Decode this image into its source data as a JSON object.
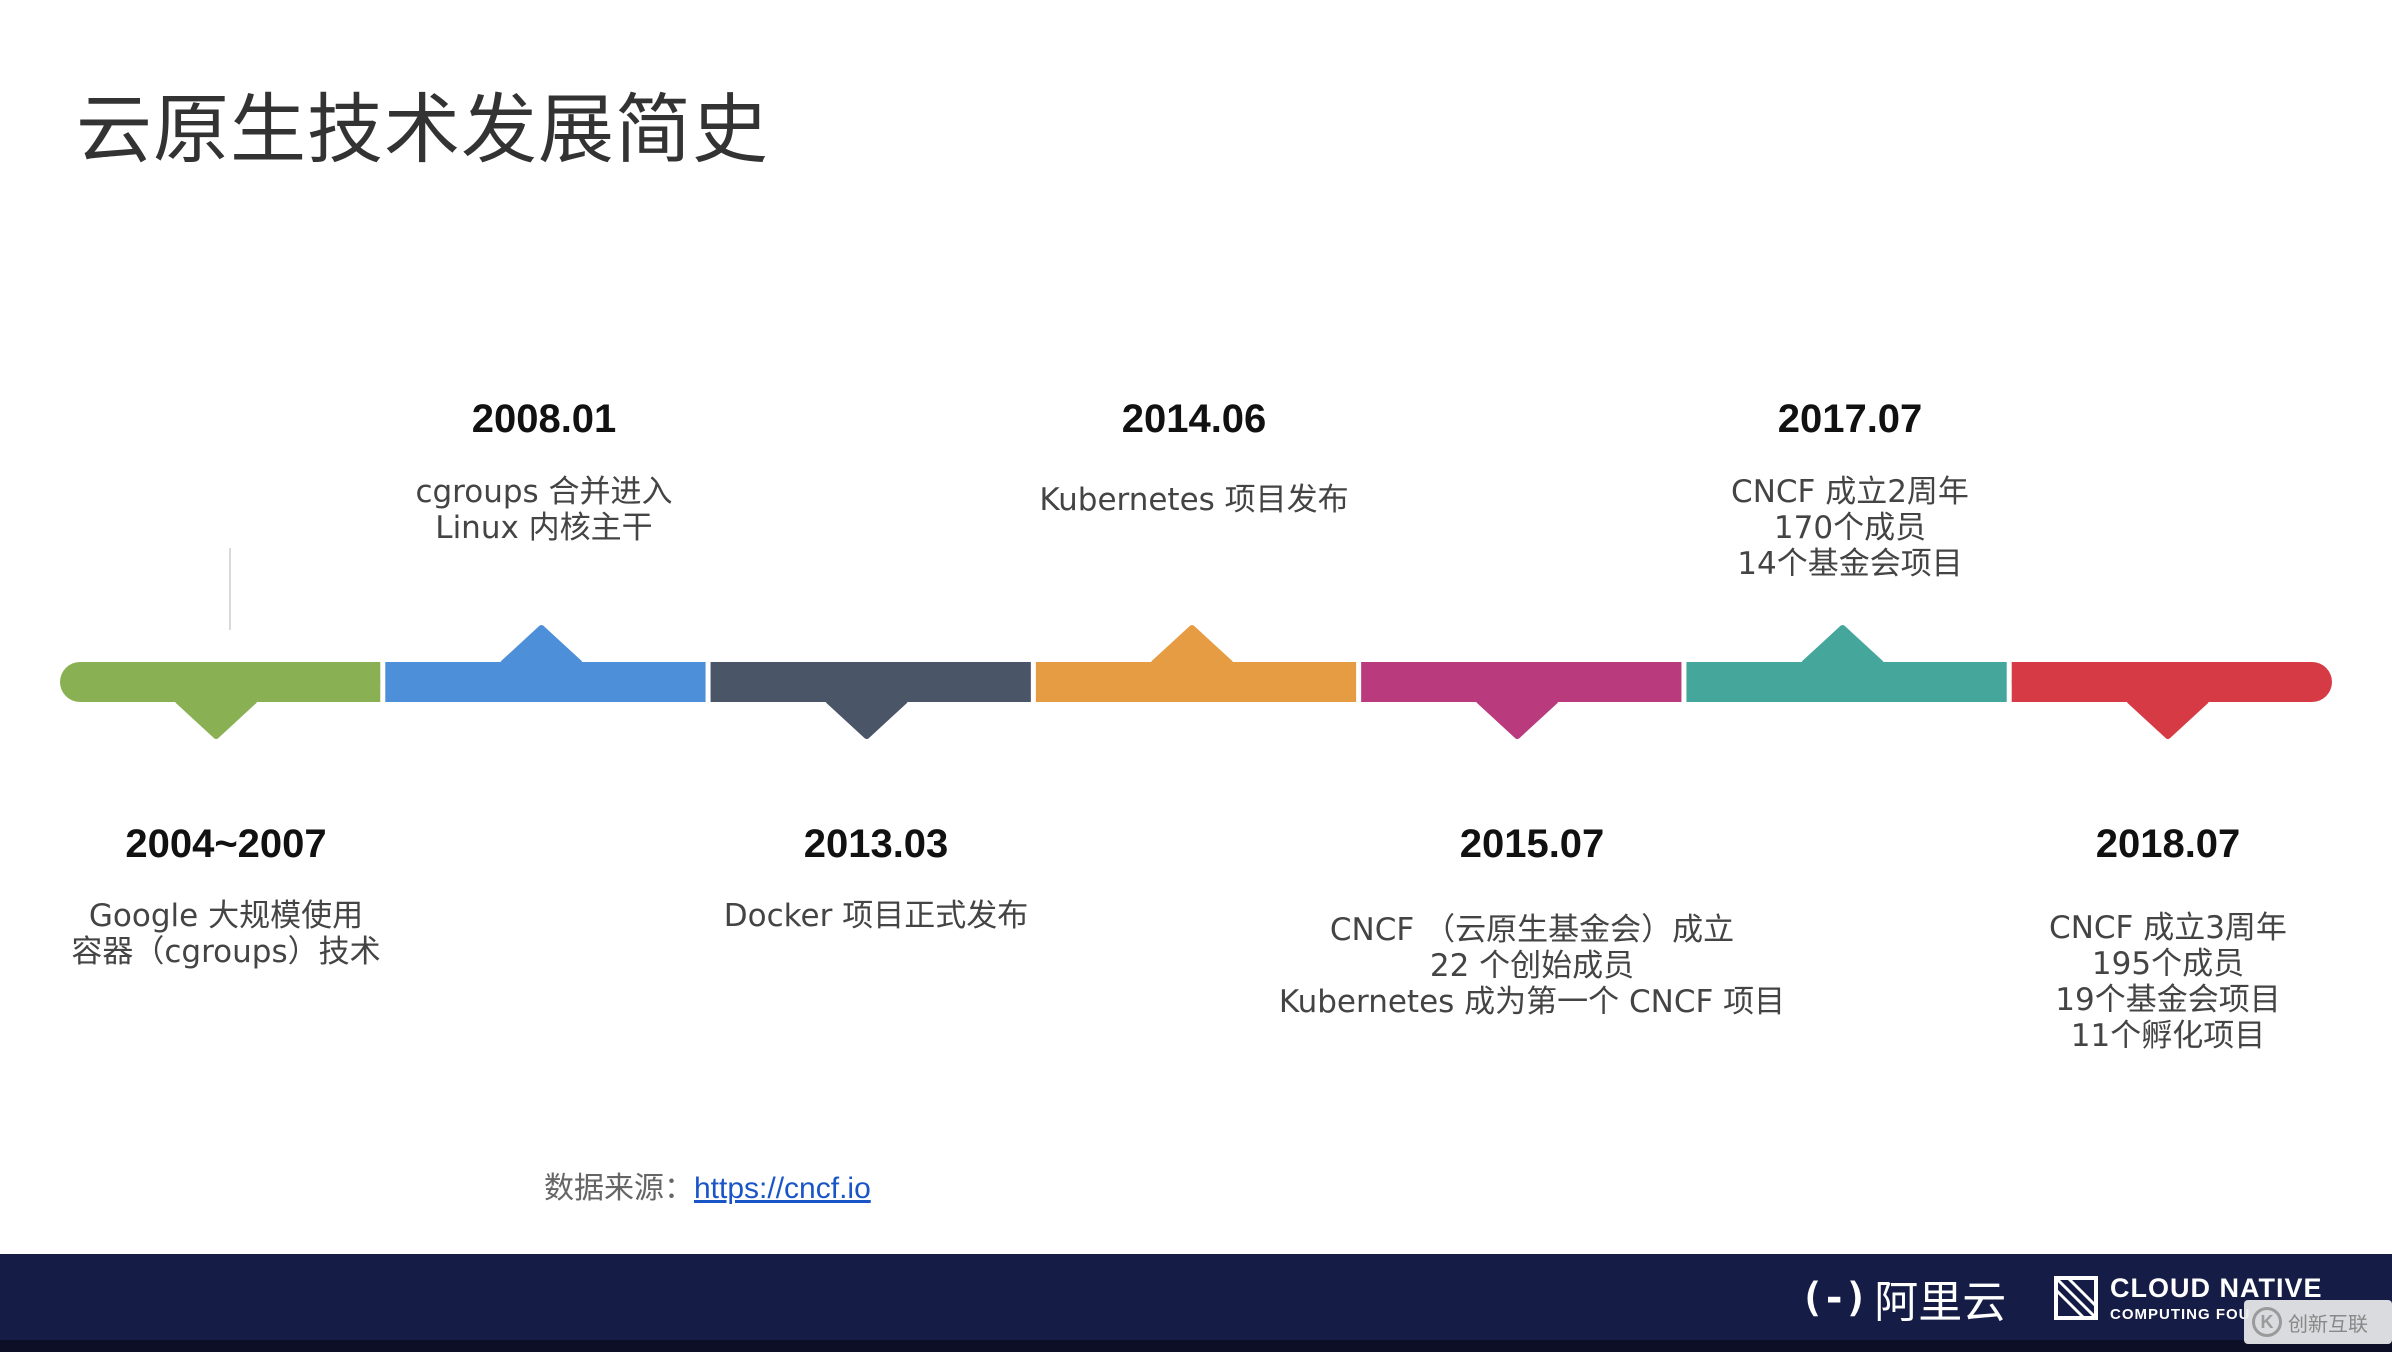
{
  "title": "云原生技术发展简史",
  "segment_colors": [
    "#8ab054",
    "#4e8fd9",
    "#4a5567",
    "#e59c42",
    "#b93a7d",
    "#45a79c",
    "#d63a44"
  ],
  "milestones": [
    {
      "date": "2004~2007",
      "lines": [
        "Google 大规模使用",
        "容器（cgroups）技术"
      ]
    },
    {
      "date": "2008.01",
      "lines": [
        "cgroups 合并进入",
        "Linux 内核主干"
      ]
    },
    {
      "date": "2013.03",
      "lines": [
        "Docker 项目正式发布"
      ]
    },
    {
      "date": "2014.06",
      "lines": [
        "Kubernetes 项目发布"
      ]
    },
    {
      "date": "2015.07",
      "lines": [
        "CNCF （云原生基金会）成立",
        "22 个创始成员",
        "Kubernetes 成为第一个 CNCF 项目"
      ]
    },
    {
      "date": "2017.07",
      "lines": [
        "CNCF 成立2周年",
        "170个成员",
        "14个基金会项目"
      ]
    },
    {
      "date": "2018.07",
      "lines": [
        "CNCF 成立3周年",
        "195个成员",
        "19个基金会项目",
        "11个孵化项目"
      ]
    }
  ],
  "source": {
    "label": "数据来源：",
    "link": "https://cncf.io"
  },
  "footer": {
    "aliyun_mark": "(-)",
    "aliyun_text": "阿里云",
    "cncf_line1": "CLOUD NATIVE",
    "cncf_line2": "COMPUTING FOU",
    "watermark_text": "创新互联",
    "watermark_icon": "K"
  }
}
